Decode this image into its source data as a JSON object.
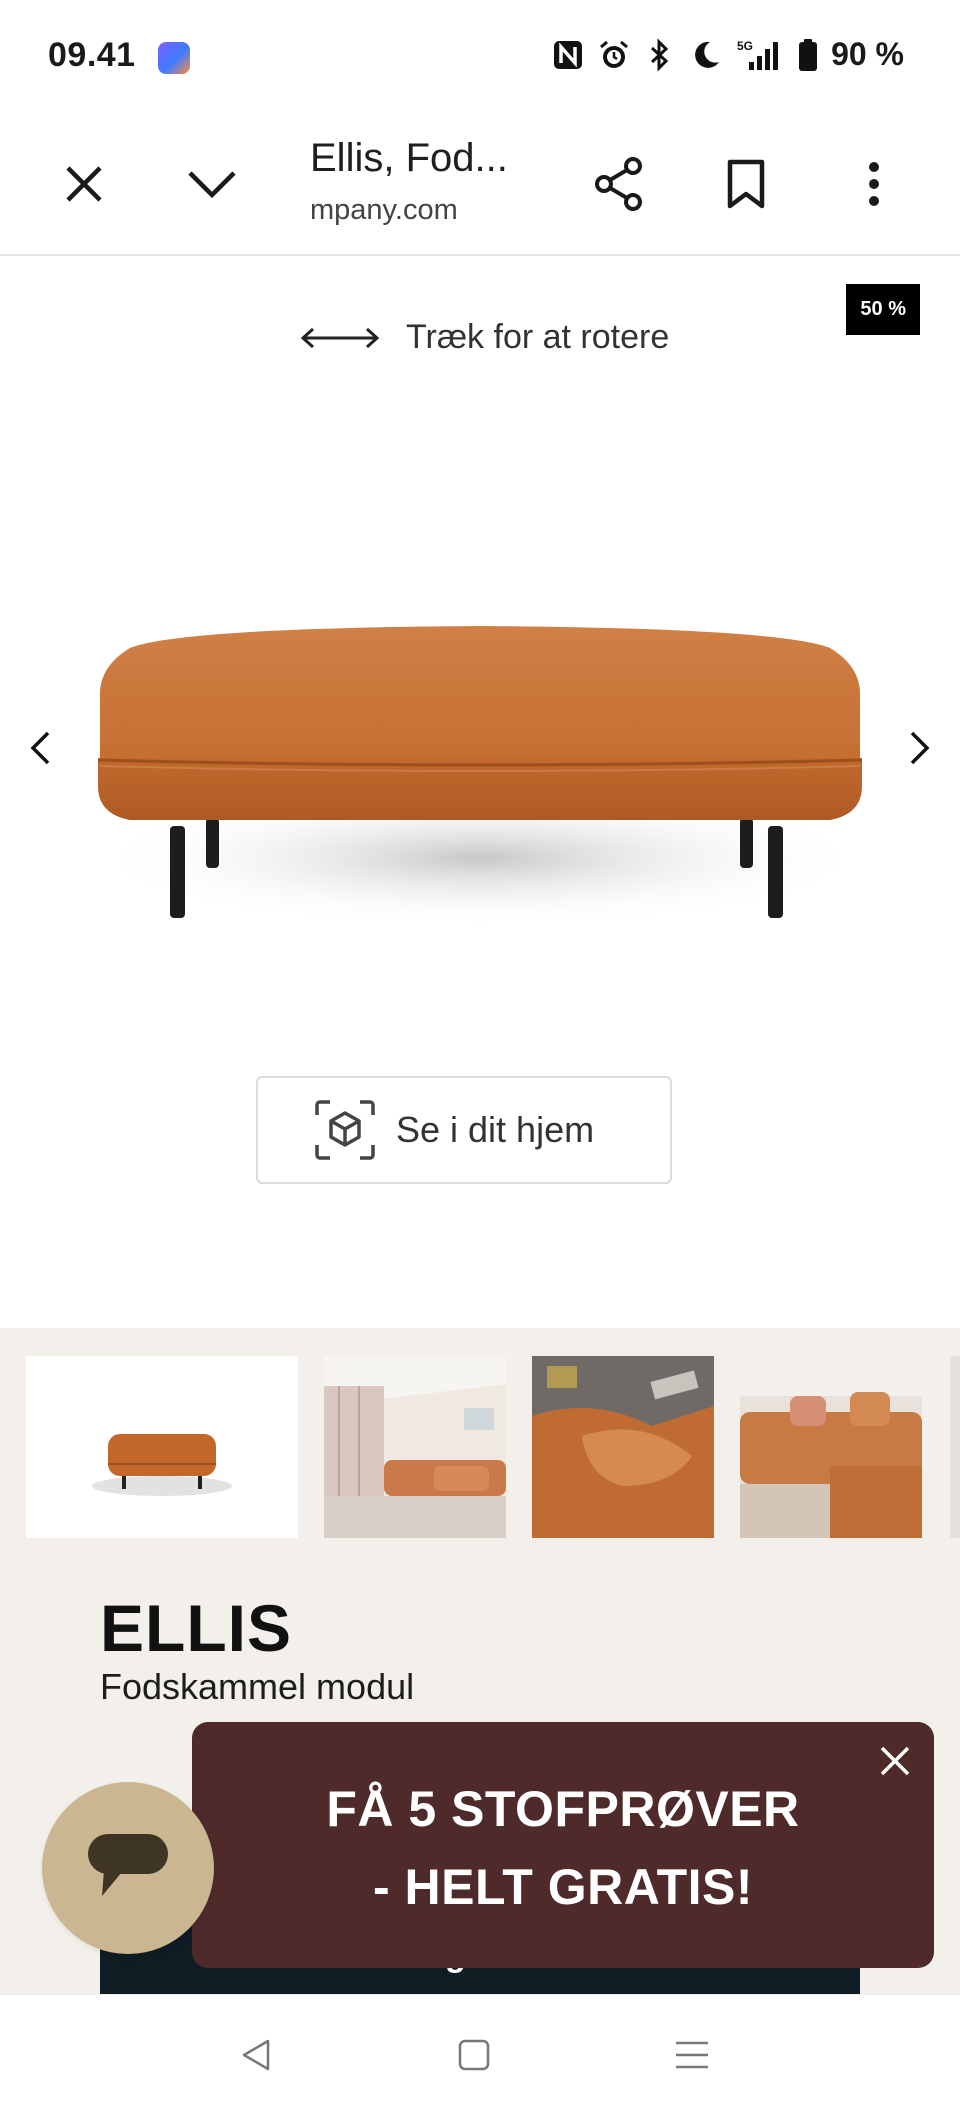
{
  "status_bar": {
    "time": "09.41",
    "battery": "90 %",
    "network": "5G"
  },
  "toolbar": {
    "title": "Ellis, Fod...",
    "url": "mpany.com"
  },
  "viewer": {
    "badge": "50 %",
    "rotate_hint": "Træk for at rotere",
    "ar_label": "Se i dit hjem"
  },
  "product": {
    "name": "ELLIS",
    "subtitle": "Fodskammel modul",
    "cart_label": "Læg i kurv",
    "fabric_color": "#c4672a"
  },
  "promo": {
    "line1": "FÅ 5 STOFPRØVER",
    "line2": "- HELT GRATIS!"
  },
  "colors": {
    "promo_bg": "#4e2a2b",
    "info_bg": "#f3f0ec",
    "chat_bg": "#cbb692",
    "cart_bg": "#0f1c23"
  }
}
